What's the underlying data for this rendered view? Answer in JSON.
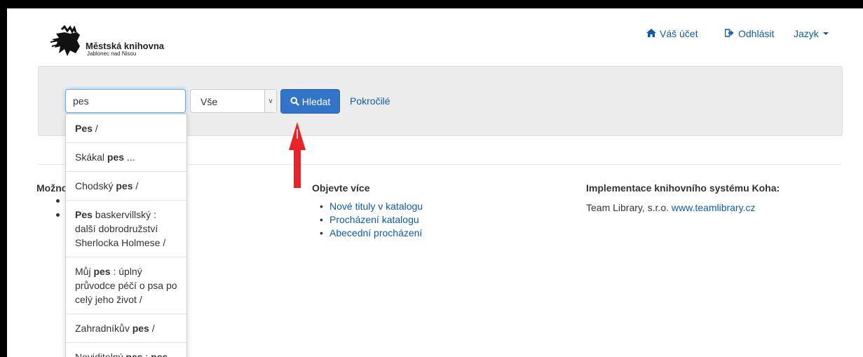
{
  "header": {
    "logo_title": "Městská knihovna",
    "logo_subtitle": "Jablonec nad Nisou",
    "nav": [
      {
        "icon": "home-icon",
        "label": "Váš účet"
      },
      {
        "icon": "logout-icon",
        "label": "Odhlásit"
      },
      {
        "icon": "chevron-down-icon",
        "label": "Jazyk"
      }
    ]
  },
  "search": {
    "query": "pes",
    "scope": "Vše",
    "search_button": "Hledat",
    "advanced_link": "Pokročilé"
  },
  "autocomplete": {
    "items": [
      {
        "segments": [
          {
            "t": "Pes",
            "b": true
          },
          {
            "t": " /",
            "b": false
          }
        ]
      },
      {
        "segments": [
          {
            "t": "Skákal ",
            "b": false
          },
          {
            "t": "pes",
            "b": true
          },
          {
            "t": " ...",
            "b": false
          }
        ]
      },
      {
        "segments": [
          {
            "t": "Chodský ",
            "b": false
          },
          {
            "t": "pes",
            "b": true
          },
          {
            "t": " /",
            "b": false
          }
        ]
      },
      {
        "segments": [
          {
            "t": "Pes",
            "b": true
          },
          {
            "t": " baskervillský : další dobrodružství Sherlocka Holmese /",
            "b": false
          }
        ]
      },
      {
        "segments": [
          {
            "t": "Můj ",
            "b": false
          },
          {
            "t": "pes",
            "b": true
          },
          {
            "t": " : úplný průvodce péčí o psa po celý jeho život /",
            "b": false
          }
        ]
      },
      {
        "segments": [
          {
            "t": "Zahradníkův ",
            "b": false
          },
          {
            "t": "pes",
            "b": true
          },
          {
            "t": " /",
            "b": false
          }
        ]
      },
      {
        "segments": [
          {
            "t": "Neviditelný ",
            "b": false
          },
          {
            "t": "pes",
            "b": true
          },
          {
            "t": " : ",
            "b": false
          },
          {
            "t": "pes",
            "b": true
          }
        ]
      }
    ]
  },
  "content": {
    "partial_heading": "Možnc",
    "discover": {
      "heading": "Objevte více",
      "links": [
        "Nové tituly v katalogu",
        "Procházení katalogu",
        "Abecední procházení"
      ]
    },
    "implementation": {
      "heading": "Implementace knihovního systému Koha:",
      "text": "Team Library, s.r.o. ",
      "link": "www.teamlibrary.cz"
    }
  },
  "annotation": {
    "arrow_color": "#e8242a"
  },
  "colors": {
    "link": "#0f5ca5",
    "primary_button": "#3174c8",
    "panel": "#ececec"
  }
}
